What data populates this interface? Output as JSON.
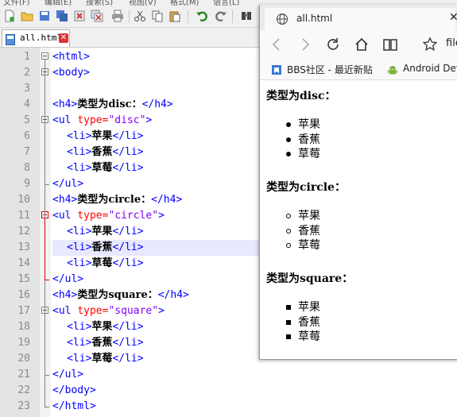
{
  "menubar": {
    "items": [
      "文件(F)",
      "编辑(E)",
      "搜索(S)",
      "视图(V)",
      "格式(M)",
      "语言(L)"
    ]
  },
  "editor": {
    "tab_label": "all.html",
    "lines": [
      {
        "n": "1",
        "parts": [
          [
            "tag",
            "<html>"
          ]
        ]
      },
      {
        "n": "2",
        "parts": [
          [
            "tag",
            "<body>"
          ]
        ]
      },
      {
        "n": "3",
        "parts": []
      },
      {
        "n": "4",
        "parts": [
          [
            "tag",
            "<h4>"
          ],
          [
            "txt",
            "类型为disc："
          ],
          [
            "tag",
            "</h4>"
          ]
        ]
      },
      {
        "n": "5",
        "parts": [
          [
            "tag",
            "<ul "
          ],
          [
            "attr",
            "type="
          ],
          [
            "val",
            "\"disc\""
          ],
          [
            "tag",
            ">"
          ]
        ]
      },
      {
        "n": "6",
        "parts": [
          [
            "txt",
            "    "
          ],
          [
            "tag",
            "<li>"
          ],
          [
            "txt",
            "苹果"
          ],
          [
            "tag",
            "</li>"
          ]
        ]
      },
      {
        "n": "7",
        "parts": [
          [
            "txt",
            "    "
          ],
          [
            "tag",
            "<li>"
          ],
          [
            "txt",
            "香蕉"
          ],
          [
            "tag",
            "</li>"
          ]
        ]
      },
      {
        "n": "8",
        "parts": [
          [
            "txt",
            "    "
          ],
          [
            "tag",
            "<li>"
          ],
          [
            "txt",
            "草莓"
          ],
          [
            "tag",
            "</li>"
          ]
        ]
      },
      {
        "n": "9",
        "parts": [
          [
            "tag",
            "</ul>"
          ]
        ]
      },
      {
        "n": "10",
        "parts": [
          [
            "tag",
            "<h4>"
          ],
          [
            "txt",
            "类型为circle："
          ],
          [
            "tag",
            "</h4>"
          ]
        ]
      },
      {
        "n": "11",
        "parts": [
          [
            "tag",
            "<ul "
          ],
          [
            "attr",
            "type="
          ],
          [
            "val",
            "\"circle\""
          ],
          [
            "tag",
            ">"
          ]
        ]
      },
      {
        "n": "12",
        "parts": [
          [
            "txt",
            "    "
          ],
          [
            "tag",
            "<li>"
          ],
          [
            "txt",
            "苹果"
          ],
          [
            "tag",
            "</li>"
          ]
        ]
      },
      {
        "n": "13",
        "parts": [
          [
            "txt",
            "    "
          ],
          [
            "tag",
            "<li>"
          ],
          [
            "txt",
            "香蕉"
          ],
          [
            "tag",
            "</li>"
          ]
        ]
      },
      {
        "n": "14",
        "parts": [
          [
            "txt",
            "    "
          ],
          [
            "tag",
            "<li>"
          ],
          [
            "txt",
            "草莓"
          ],
          [
            "tag",
            "</li>"
          ]
        ]
      },
      {
        "n": "15",
        "parts": [
          [
            "tag",
            "</ul>"
          ]
        ]
      },
      {
        "n": "16",
        "parts": [
          [
            "tag",
            "<h4>"
          ],
          [
            "txt",
            "类型为square："
          ],
          [
            "tag",
            "</h4>"
          ]
        ]
      },
      {
        "n": "17",
        "parts": [
          [
            "tag",
            "<ul "
          ],
          [
            "attr",
            "type="
          ],
          [
            "val",
            "\"square\""
          ],
          [
            "tag",
            ">"
          ]
        ]
      },
      {
        "n": "18",
        "parts": [
          [
            "txt",
            "    "
          ],
          [
            "tag",
            "<li>"
          ],
          [
            "txt",
            "苹果"
          ],
          [
            "tag",
            "</li>"
          ]
        ]
      },
      {
        "n": "19",
        "parts": [
          [
            "txt",
            "    "
          ],
          [
            "tag",
            "<li>"
          ],
          [
            "txt",
            "香蕉"
          ],
          [
            "tag",
            "</li>"
          ]
        ]
      },
      {
        "n": "20",
        "parts": [
          [
            "txt",
            "    "
          ],
          [
            "tag",
            "<li>"
          ],
          [
            "txt",
            "草莓"
          ],
          [
            "tag",
            "</li>"
          ]
        ]
      },
      {
        "n": "21",
        "parts": [
          [
            "tag",
            "</ul>"
          ]
        ]
      },
      {
        "n": "22",
        "parts": [
          [
            "tag",
            "</body>"
          ]
        ]
      },
      {
        "n": "23",
        "parts": [
          [
            "tag",
            "</html>"
          ]
        ]
      }
    ],
    "current_line": "13",
    "colors": {
      "tag": "#0000ff",
      "attr": "#ff0000",
      "value": "#8000ff",
      "fold_active": "#d00000"
    }
  },
  "browser": {
    "tab_title": "all.html",
    "address_text": "file",
    "favorites": [
      {
        "label": "BBS社区 - 最近新贴",
        "icon": "bookmark-icon"
      },
      {
        "label": "Android Dev",
        "icon": "android-icon"
      }
    ],
    "page": {
      "heading_disc": "类型为disc：",
      "heading_circle": "类型为circle：",
      "heading_square": "类型为square：",
      "items": [
        "苹果",
        "香蕉",
        "草莓"
      ]
    }
  }
}
